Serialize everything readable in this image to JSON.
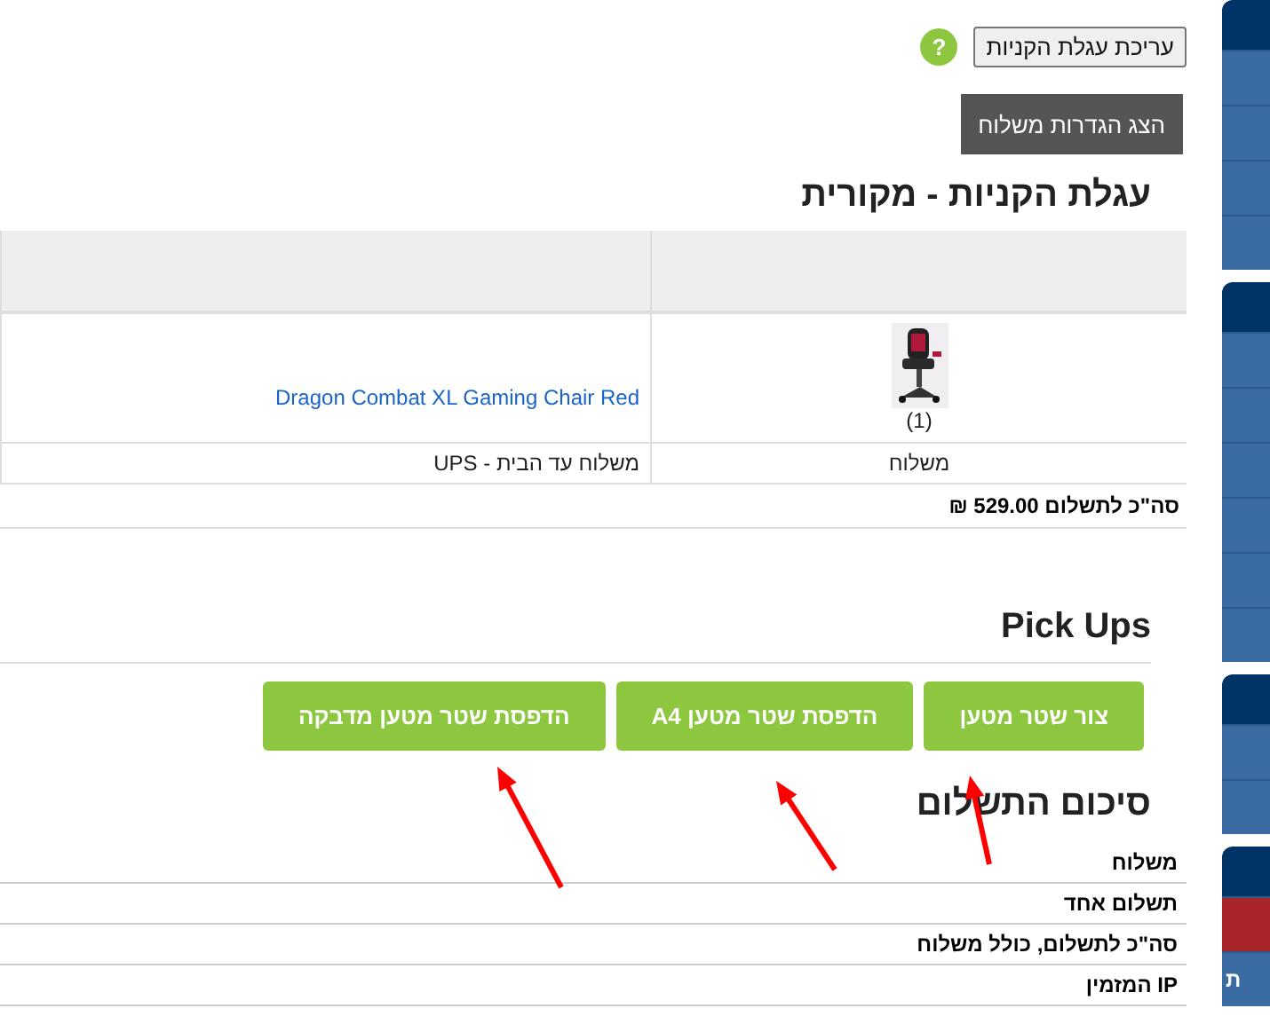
{
  "edit_cart_button": "עריכת עגלת הקניות",
  "help_button": "?",
  "shipping_settings_button": "הצג הגדרות משלוח",
  "cart": {
    "title": "עגלת הקניות - מקורית",
    "items": [
      {
        "kind": "picture",
        "quantity": "(1)",
        "name": "Dragon Combat XL Gaming Chair Red"
      }
    ],
    "shipping": {
      "label": "משלוח",
      "value": "משלוח עד הבית - UPS"
    },
    "total": "סה\"כ לתשלום 529.00 ₪"
  },
  "pickups": {
    "title": "Pick Ups",
    "buttons": [
      "צור שטר מטען",
      "הדפסת שטר מטען A4",
      "הדפסת שטר מטען מדבקה"
    ]
  },
  "summary": {
    "title": "סיכום התשלום",
    "rows": [
      "משלוח",
      "תשלום אחד",
      "סה\"כ לתשלום, כולל משלוח",
      "IP המזמין"
    ]
  },
  "sidebar": {
    "groups": [
      {
        "items": [
          {
            "selected": false
          },
          {
            "selected": false
          },
          {
            "selected": false
          },
          {
            "selected": false
          }
        ]
      },
      {
        "items": [
          {
            "selected": false
          },
          {
            "selected": false
          },
          {
            "selected": false
          },
          {
            "selected": false
          },
          {
            "selected": false
          },
          {
            "selected": false
          }
        ]
      },
      {
        "items": [
          {
            "selected": false
          },
          {
            "selected": false
          }
        ]
      },
      {
        "items": [
          {
            "selected": true
          },
          {
            "selected": false,
            "label": "ת"
          }
        ]
      }
    ]
  }
}
